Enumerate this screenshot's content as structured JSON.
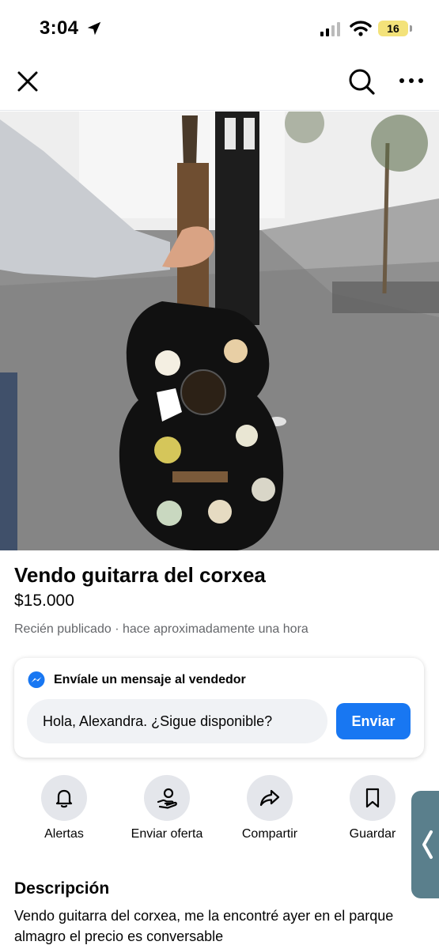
{
  "status_bar": {
    "time": "3:04",
    "battery": "16"
  },
  "colors": {
    "accent": "#1877f2",
    "battery": "#f3e27a",
    "side_tab": "#5a7f8c"
  },
  "icons": {
    "close": "close-icon",
    "search": "search-icon",
    "more": "more-icon",
    "messenger": "messenger-icon",
    "alerts": "bell-icon",
    "offer": "offer-icon",
    "share": "share-icon",
    "save": "bookmark-icon",
    "tab": "chevron-left-icon"
  },
  "listing": {
    "title": "Vendo guitarra del corxea",
    "price": "$15.000",
    "meta": "Recién publicado · hace aproximadamente una hora"
  },
  "message": {
    "header": "Envíale un mensaje al vendedor",
    "input_value": "Hola, Alexandra. ¿Sigue disponible?",
    "send_label": "Enviar"
  },
  "actions": [
    {
      "label": "Alertas"
    },
    {
      "label": "Enviar oferta"
    },
    {
      "label": "Compartir"
    },
    {
      "label": "Guardar"
    }
  ],
  "description": {
    "heading": "Descripción",
    "text": "Vendo guitarra del corxea, me la encontré ayer en el parque almagro el precio es conversable"
  }
}
